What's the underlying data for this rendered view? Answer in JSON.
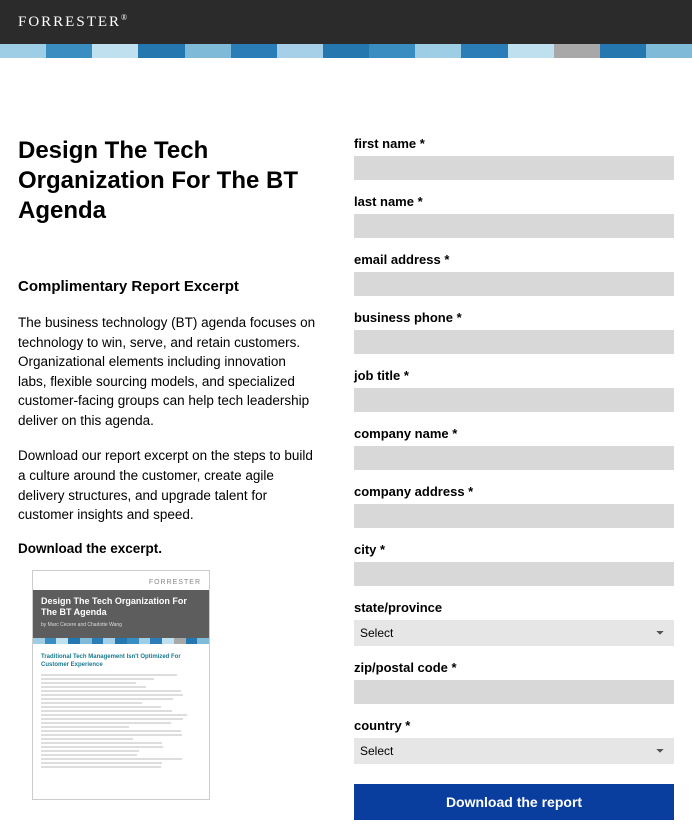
{
  "header": {
    "logo": "FORRESTER"
  },
  "colorbar": [
    "#9ecde6",
    "#3a8dc0",
    "#bfe0ef",
    "#2577af",
    "#7fbad9",
    "#2a7db6",
    "#a5d0e7",
    "#2577af",
    "#3a8dc0",
    "#9ecde6",
    "#2a7db6",
    "#bfe0ef",
    "#a8a8a8",
    "#2577af",
    "#7fbad9"
  ],
  "content": {
    "title": "Design The Tech Organization For The BT Agenda",
    "subtitle": "Complimentary Report Excerpt",
    "p1": "The business technology (BT) agenda focuses on technology to win, serve, and retain customers. Organizational elements including innovation labs, flexible sourcing models, and specialized customer-facing groups can help tech leadership deliver on this agenda.",
    "p2": "Download our report excerpt on the steps to build a culture around the customer, create agile delivery structures, and upgrade talent for customer insights and speed.",
    "download_label": "Download the excerpt."
  },
  "thumb": {
    "brand": "FORRESTER",
    "title": "Design The Tech Organization For The BT Agenda",
    "section": "Traditional Tech Management Isn't Optimized For Customer Experience"
  },
  "form": {
    "fields": [
      {
        "label": "first name *",
        "type": "text"
      },
      {
        "label": "last name *",
        "type": "text"
      },
      {
        "label": "email address *",
        "type": "text"
      },
      {
        "label": "business phone *",
        "type": "text"
      },
      {
        "label": "job title *",
        "type": "text"
      },
      {
        "label": "company name *",
        "type": "text"
      },
      {
        "label": "company address *",
        "type": "text"
      },
      {
        "label": "city *",
        "type": "text"
      },
      {
        "label": "state/province",
        "type": "select",
        "selected": "Select"
      },
      {
        "label": "zip/postal code *",
        "type": "text"
      },
      {
        "label": "country *",
        "type": "select",
        "selected": "Select"
      }
    ],
    "submit": "Download the report"
  }
}
